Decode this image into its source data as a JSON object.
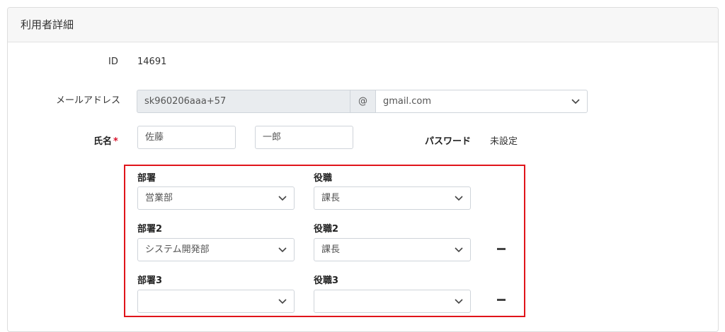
{
  "panel": {
    "title": "利用者詳細"
  },
  "id_row": {
    "label": "ID",
    "value": "14691"
  },
  "email_row": {
    "label": "メールアドレス",
    "local_part": "sk960206aaa+57",
    "at": "@",
    "domain": "gmail.com"
  },
  "name_row": {
    "label": "氏名",
    "required_mark": "*",
    "last_name": "佐藤",
    "first_name": "一郎",
    "password_label": "パスワード",
    "password_value": "未設定"
  },
  "assignments": [
    {
      "dept_label": "部署",
      "dept_value": "営業部",
      "role_label": "役職",
      "role_value": "課長"
    },
    {
      "dept_label": "部署2",
      "dept_value": "システム開発部",
      "role_label": "役職2",
      "role_value": "課長",
      "remove": "−"
    },
    {
      "dept_label": "部署3",
      "dept_value": "",
      "role_label": "役職3",
      "role_value": "",
      "remove": "−"
    }
  ],
  "colors": {
    "highlight_border": "#e0141a",
    "required_mark": "#d9122b",
    "disabled_field": "#e9ecef"
  },
  "icons": {
    "select_arrow": "chevron-down-icon",
    "remove_row": "minus-icon"
  }
}
